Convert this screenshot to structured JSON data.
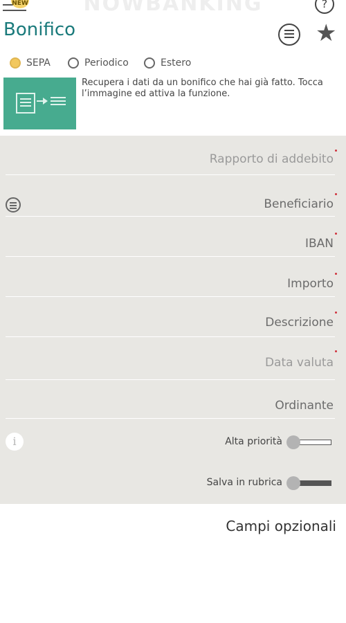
{
  "header": {
    "brand": "NOWBANKING",
    "new_badge": "NEW",
    "title": "Bonifico",
    "help_glyph": "?",
    "icons": [
      "menu-icon",
      "help-icon",
      "list-icon",
      "star-icon"
    ]
  },
  "transfer_types": [
    {
      "label": "SEPA",
      "selected": true
    },
    {
      "label": "Periodico",
      "selected": false
    },
    {
      "label": "Estero",
      "selected": false
    }
  ],
  "banner": {
    "text": "Recupera i dati da un bonifico che hai già fatto. Tocca l’immagine ed attiva la funzione."
  },
  "form": {
    "fields": [
      {
        "label": "Rapporto di addebito",
        "required": true
      },
      {
        "label": "Beneficiario",
        "required": true
      },
      {
        "label": "IBAN",
        "required": true
      },
      {
        "label": "Importo",
        "required": true
      },
      {
        "label": "Descrizione",
        "required": true
      },
      {
        "label": "Data valuta",
        "required": true
      },
      {
        "label": "Ordinante",
        "required": false
      }
    ],
    "toggles": [
      {
        "label": "Alta priorità",
        "on": false
      },
      {
        "label": "Salva in rubrica",
        "on": true
      }
    ],
    "info_glyph": "i"
  },
  "optional_fields_label": "Campi opzionali",
  "colors": {
    "accent": "#1a7a7b",
    "banner": "#47ab8f",
    "radio_selected": "#f2c85e",
    "required_dot": "#d0323c",
    "panel": "#e8e7e3"
  }
}
